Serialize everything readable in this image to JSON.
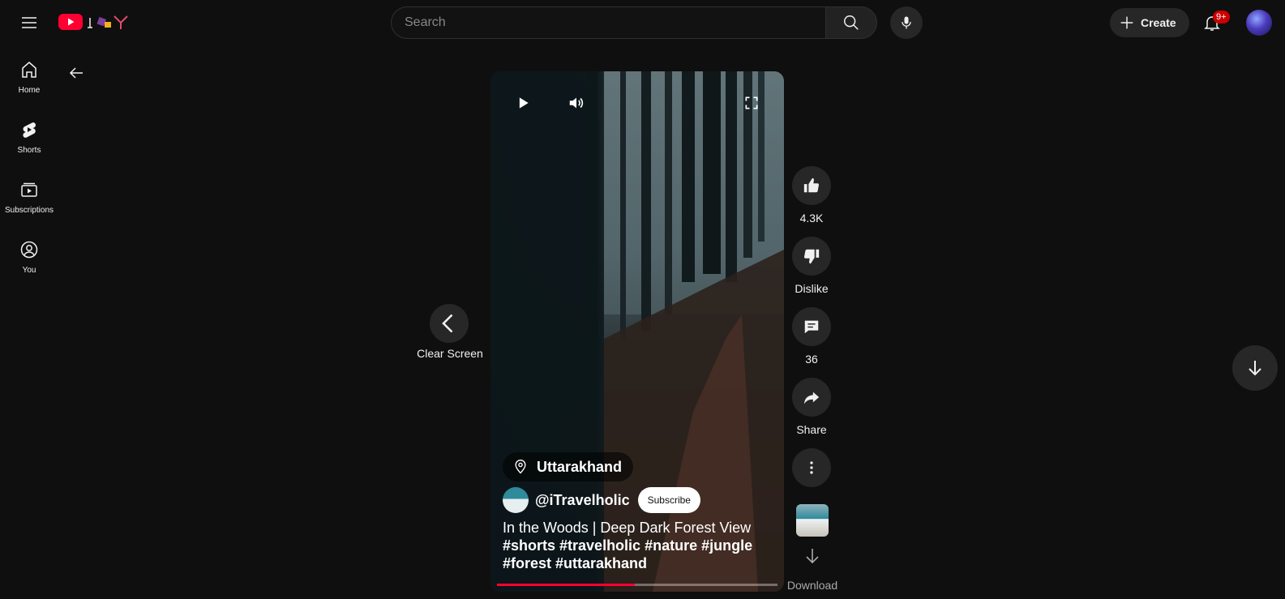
{
  "header": {
    "search_placeholder": "Search",
    "create_label": "Create",
    "notification_count": "9+"
  },
  "sidebar": {
    "items": [
      {
        "label": "Home",
        "icon": "home-icon"
      },
      {
        "label": "Shorts",
        "icon": "shorts-icon"
      },
      {
        "label": "Subscriptions",
        "icon": "subscriptions-icon"
      },
      {
        "label": "You",
        "icon": "you-icon"
      }
    ]
  },
  "short": {
    "location": "Uttarakhand",
    "channel": "@iTravelholic",
    "subscribe_label": "Subscribe",
    "title": "In the Woods | Deep Dark Forest View",
    "hashtags": "#shorts #travelholic #nature #jungle #forest #uttarakhand",
    "progress_fraction": 0.49
  },
  "actions": {
    "likes": "4.3K",
    "dislike_label": "Dislike",
    "comments": "36",
    "share_label": "Share",
    "download_label": "Download"
  },
  "nav": {
    "clear_screen_label": "Clear Screen"
  },
  "colors": {
    "brand": "#ff0033",
    "background": "#0f0f0f",
    "button_bg": "#272727"
  }
}
